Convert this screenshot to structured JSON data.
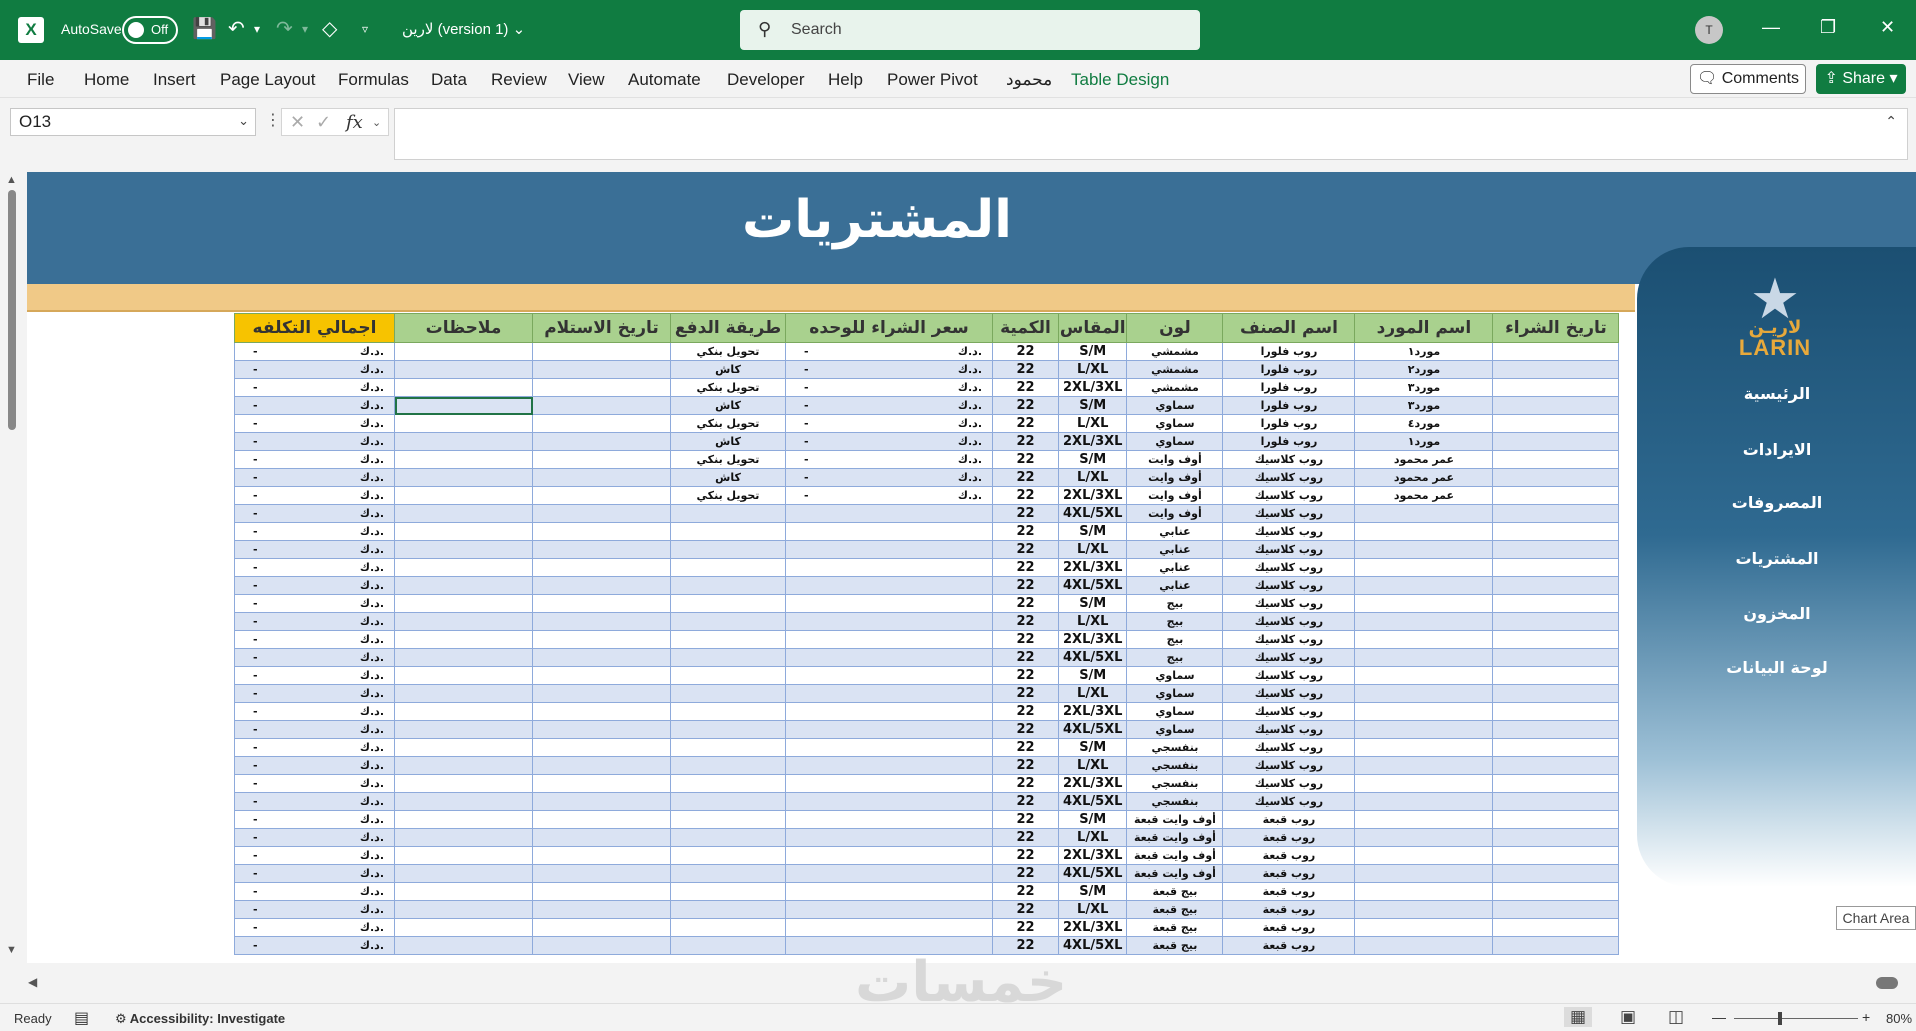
{
  "titlebar": {
    "autosave_label": "AutoSave",
    "autosave_state": "Off",
    "filename": "لارين (version 1)",
    "search_placeholder": "Search",
    "avatar_initial": "T"
  },
  "ribbon": {
    "tabs": [
      "File",
      "Home",
      "Insert",
      "Page Layout",
      "Formulas",
      "Data",
      "Review",
      "View",
      "Automate",
      "Developer",
      "Help",
      "Power Pivot",
      "محمود",
      "Table Design"
    ],
    "comments_label": "Comments",
    "share_label": "Share"
  },
  "formula_bar": {
    "name_box": "O13",
    "fx_label": "fx",
    "value": ""
  },
  "sheet": {
    "title": "المشتريات",
    "columns": [
      "اجمالي التكلفه",
      "ملاحظات",
      "تاريخ الاستلام",
      "طريقة الدفع",
      "سعر الشراء للوحده",
      "الكمية",
      "المقاس",
      "لون",
      "اسم الصنف",
      "اسم المورد",
      "تاريخ الشراء"
    ],
    "currency": "د.ك.",
    "dash": "-",
    "rows": [
      {
        "payment": "تحويل بنكي",
        "has_price": true,
        "qty": "22",
        "size": "S/M",
        "color": "مشمشي",
        "item": "روب فلورا",
        "supplier": "مورد١"
      },
      {
        "payment": "كاش",
        "has_price": true,
        "qty": "22",
        "size": "L/XL",
        "color": "مشمشي",
        "item": "روب فلورا",
        "supplier": "مورد٢"
      },
      {
        "payment": "تحويل بنكي",
        "has_price": true,
        "qty": "22",
        "size": "2XL/3XL",
        "color": "مشمشي",
        "item": "روب فلورا",
        "supplier": "مورد٣"
      },
      {
        "payment": "كاش",
        "has_price": true,
        "qty": "22",
        "size": "S/M",
        "color": "سماوي",
        "item": "روب فلورا",
        "supplier": "مورد٣"
      },
      {
        "payment": "تحويل بنكي",
        "has_price": true,
        "qty": "22",
        "size": "L/XL",
        "color": "سماوي",
        "item": "روب فلورا",
        "supplier": "مورد٤"
      },
      {
        "payment": "كاش",
        "has_price": true,
        "qty": "22",
        "size": "2XL/3XL",
        "color": "سماوي",
        "item": "روب فلورا",
        "supplier": "مورد١"
      },
      {
        "payment": "تحويل بنكي",
        "has_price": true,
        "qty": "22",
        "size": "S/M",
        "color": "أوف وايت",
        "item": "روب كلاسيك",
        "supplier": "عمر محمود"
      },
      {
        "payment": "كاش",
        "has_price": true,
        "qty": "22",
        "size": "L/XL",
        "color": "أوف وايت",
        "item": "روب كلاسيك",
        "supplier": "عمر محمود"
      },
      {
        "payment": "تحويل بنكي",
        "has_price": true,
        "qty": "22",
        "size": "2XL/3XL",
        "color": "أوف وايت",
        "item": "روب كلاسيك",
        "supplier": "عمر محمود"
      },
      {
        "payment": "",
        "has_price": false,
        "qty": "22",
        "size": "4XL/5XL",
        "color": "أوف وايت",
        "item": "روب كلاسيك",
        "supplier": ""
      },
      {
        "payment": "",
        "has_price": false,
        "qty": "22",
        "size": "S/M",
        "color": "عنابي",
        "item": "روب كلاسيك",
        "supplier": ""
      },
      {
        "payment": "",
        "has_price": false,
        "qty": "22",
        "size": "L/XL",
        "color": "عنابي",
        "item": "روب كلاسيك",
        "supplier": ""
      },
      {
        "payment": "",
        "has_price": false,
        "qty": "22",
        "size": "2XL/3XL",
        "color": "عنابي",
        "item": "روب كلاسيك",
        "supplier": ""
      },
      {
        "payment": "",
        "has_price": false,
        "qty": "22",
        "size": "4XL/5XL",
        "color": "عنابي",
        "item": "روب كلاسيك",
        "supplier": ""
      },
      {
        "payment": "",
        "has_price": false,
        "qty": "22",
        "size": "S/M",
        "color": "بيج",
        "item": "روب كلاسيك",
        "supplier": ""
      },
      {
        "payment": "",
        "has_price": false,
        "qty": "22",
        "size": "L/XL",
        "color": "بيج",
        "item": "روب كلاسيك",
        "supplier": ""
      },
      {
        "payment": "",
        "has_price": false,
        "qty": "22",
        "size": "2XL/3XL",
        "color": "بيج",
        "item": "روب كلاسيك",
        "supplier": ""
      },
      {
        "payment": "",
        "has_price": false,
        "qty": "22",
        "size": "4XL/5XL",
        "color": "بيج",
        "item": "روب كلاسيك",
        "supplier": ""
      },
      {
        "payment": "",
        "has_price": false,
        "qty": "22",
        "size": "S/M",
        "color": "سماوي",
        "item": "روب كلاسيك",
        "supplier": ""
      },
      {
        "payment": "",
        "has_price": false,
        "qty": "22",
        "size": "L/XL",
        "color": "سماوي",
        "item": "روب كلاسيك",
        "supplier": ""
      },
      {
        "payment": "",
        "has_price": false,
        "qty": "22",
        "size": "2XL/3XL",
        "color": "سماوي",
        "item": "روب كلاسيك",
        "supplier": ""
      },
      {
        "payment": "",
        "has_price": false,
        "qty": "22",
        "size": "4XL/5XL",
        "color": "سماوي",
        "item": "روب كلاسيك",
        "supplier": ""
      },
      {
        "payment": "",
        "has_price": false,
        "qty": "22",
        "size": "S/M",
        "color": "بنفسجي",
        "item": "روب كلاسيك",
        "supplier": ""
      },
      {
        "payment": "",
        "has_price": false,
        "qty": "22",
        "size": "L/XL",
        "color": "بنفسجي",
        "item": "روب كلاسيك",
        "supplier": ""
      },
      {
        "payment": "",
        "has_price": false,
        "qty": "22",
        "size": "2XL/3XL",
        "color": "بنفسجي",
        "item": "روب كلاسيك",
        "supplier": ""
      },
      {
        "payment": "",
        "has_price": false,
        "qty": "22",
        "size": "4XL/5XL",
        "color": "بنفسجي",
        "item": "روب كلاسيك",
        "supplier": ""
      },
      {
        "payment": "",
        "has_price": false,
        "qty": "22",
        "size": "S/M",
        "color": "أوف وايت قبعة",
        "item": "روب قبعة",
        "supplier": ""
      },
      {
        "payment": "",
        "has_price": false,
        "qty": "22",
        "size": "L/XL",
        "color": "أوف وايت قبعة",
        "item": "روب قبعة",
        "supplier": ""
      },
      {
        "payment": "",
        "has_price": false,
        "qty": "22",
        "size": "2XL/3XL",
        "color": "أوف وايت قبعة",
        "item": "روب قبعة",
        "supplier": ""
      },
      {
        "payment": "",
        "has_price": false,
        "qty": "22",
        "size": "4XL/5XL",
        "color": "أوف وايت قبعة",
        "item": "روب قبعة",
        "supplier": ""
      },
      {
        "payment": "",
        "has_price": false,
        "qty": "22",
        "size": "S/M",
        "color": "بيج قبعة",
        "item": "روب قبعة",
        "supplier": ""
      },
      {
        "payment": "",
        "has_price": false,
        "qty": "22",
        "size": "L/XL",
        "color": "بيج قبعة",
        "item": "روب قبعة",
        "supplier": ""
      },
      {
        "payment": "",
        "has_price": false,
        "qty": "22",
        "size": "2XL/3XL",
        "color": "بيج قبعة",
        "item": "روب قبعة",
        "supplier": ""
      },
      {
        "payment": "",
        "has_price": false,
        "qty": "22",
        "size": "4XL/5XL",
        "color": "بيج قبعة",
        "item": "روب قبعة",
        "supplier": ""
      }
    ]
  },
  "side_panel": {
    "logo_ar": "لاريـن",
    "logo_en": "LARIN",
    "nav": [
      "الرئيسية",
      "الايرادات",
      "المصروفات",
      "المشتريات",
      "المخزون",
      "لوحة البيانات"
    ]
  },
  "chart_tooltip": "Chart Area",
  "watermark": "خمسات",
  "status": {
    "ready": "Ready",
    "accessibility": "Accessibility: Investigate",
    "zoom": "80%"
  },
  "colors": {
    "excel_green": "#107c41",
    "banner_blue": "#3a6f96",
    "header_green": "#a9d18e",
    "header_yellow": "#f7c300",
    "band_blue": "#dae3f3",
    "tan_bar": "#f0c987",
    "logo_gold": "#e7a93b"
  }
}
